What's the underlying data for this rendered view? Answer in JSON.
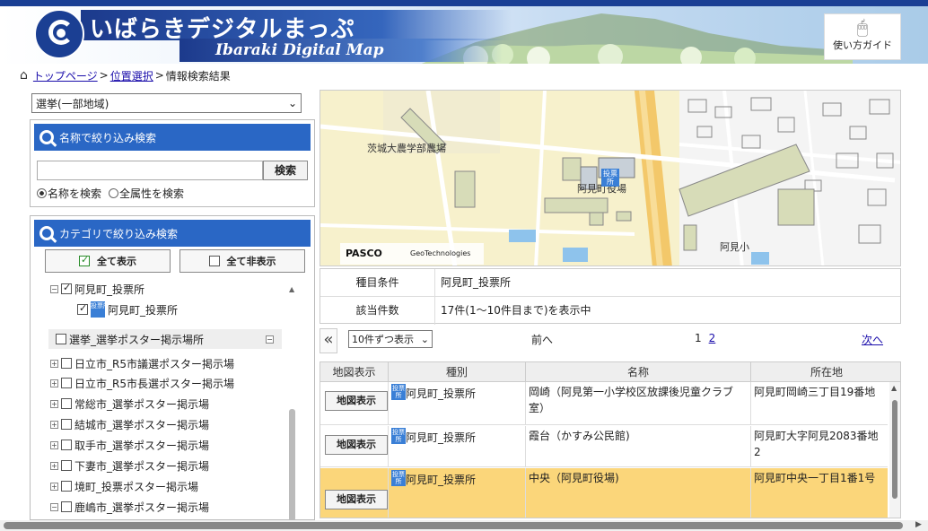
{
  "header": {
    "title": "いばらきデジタルまっぷ",
    "subtitle": "Ibaraki Digital Map",
    "guide_label": "使い方ガイド"
  },
  "breadcrumb": {
    "home": "トップページ",
    "sep": ">",
    "location": "位置選択",
    "current": "情報検索結果"
  },
  "left": {
    "layer_select": "選挙(一部地域)",
    "name_search": {
      "heading": "名称で絞り込み検索",
      "input_value": "",
      "button": "検索",
      "radio_name": "名称を検索",
      "radio_all": "全属性を検索"
    },
    "category": {
      "heading": "カテゴリで絞り込み検索",
      "show_all": "全て表示",
      "hide_all": "全て非表示",
      "tree": [
        {
          "label": "阿見町_投票所",
          "checked": true,
          "expanded": true
        },
        {
          "label": "阿見町_投票所",
          "checked": true,
          "child": true
        },
        {
          "label": "選挙_選挙ポスター掲示場所",
          "checked": false,
          "group": true
        },
        {
          "label": "日立市_R5市議選ポスター掲示場",
          "checked": false
        },
        {
          "label": "日立市_R5市長選ポスター掲示場",
          "checked": false
        },
        {
          "label": "常総市_選挙ポスター掲示場",
          "checked": false
        },
        {
          "label": "結城市_選挙ポスター掲示場",
          "checked": false
        },
        {
          "label": "取手市_選挙ポスター掲示場",
          "checked": false
        },
        {
          "label": "下妻市_選挙ポスター掲示場",
          "checked": false
        },
        {
          "label": "境町_投票ポスター掲示場",
          "checked": false
        },
        {
          "label": "鹿嶋市_選挙ポスター掲示場",
          "checked": false
        }
      ],
      "badge": "投票所"
    }
  },
  "map": {
    "label_farm": "茨城大農学部農場",
    "label_office": "阿見町役場",
    "label_school": "阿見小",
    "attribution1": "PASCO",
    "attribution2": "GeoTechnologies",
    "marker": "投票所"
  },
  "info": {
    "rows": [
      {
        "label": "種目条件",
        "value": "阿見町_投票所"
      },
      {
        "label": "該当件数",
        "value": "17件(1〜10件目まで)を表示中"
      }
    ]
  },
  "pager": {
    "back": "«",
    "per_page": "10件ずつ表示",
    "prev": "前へ",
    "page1": "1",
    "page2": "2",
    "next": "次へ"
  },
  "results": {
    "columns": [
      "地図表示",
      "種別",
      "名称",
      "所在地"
    ],
    "button": "地図表示",
    "badge": "投票所",
    "rows": [
      {
        "type": "阿見町_投票所",
        "name": "岡崎（阿見第一小学校区放課後児童クラブ室）",
        "address": "阿見町岡崎三丁目19番地"
      },
      {
        "type": "阿見町_投票所",
        "name": "霞台（かすみ公民館)",
        "address": "阿見町大字阿見2083番地2"
      },
      {
        "type": "阿見町_投票所",
        "name": "中央（阿見町役場)",
        "address": "阿見町中央一丁目1番1号"
      }
    ]
  }
}
